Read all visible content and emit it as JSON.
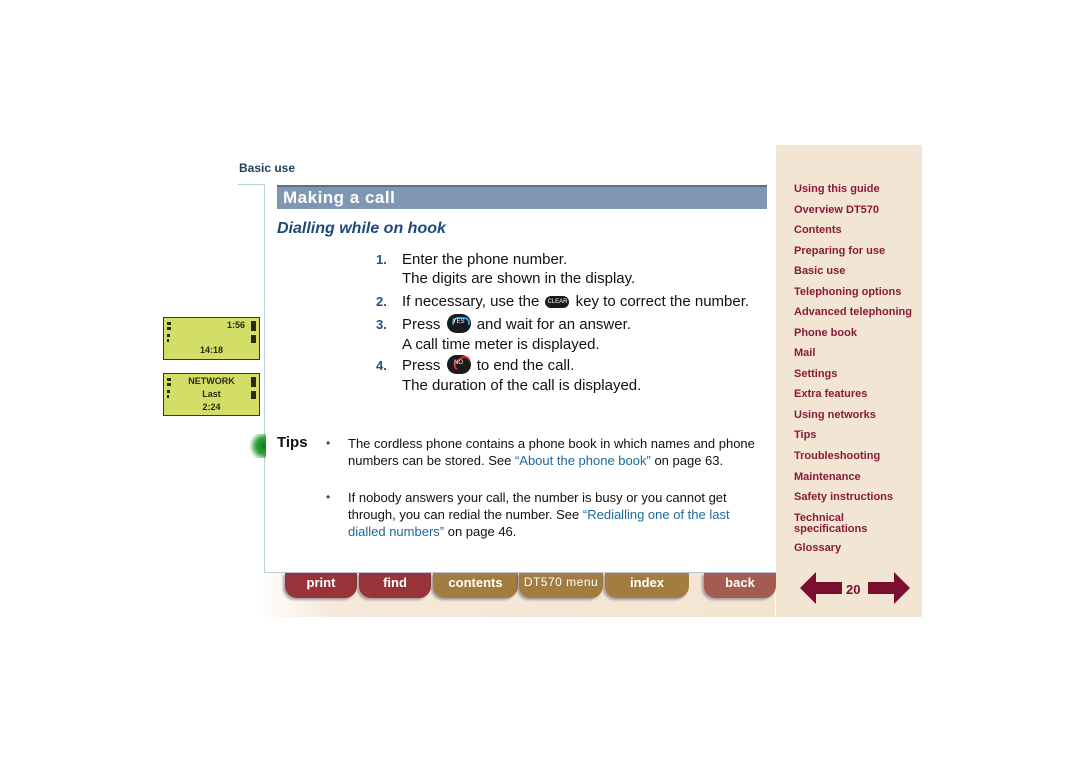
{
  "header": {
    "section": "Basic use"
  },
  "page": {
    "title": "Making a call",
    "subtitle": "Dialling while on hook",
    "steps": [
      {
        "num": "1.",
        "line1": "Enter the phone number.",
        "line2": "The digits are shown in the display."
      },
      {
        "num": "2.",
        "pre": "If necessary, use the",
        "key": "CLEAR",
        "post": "key to correct the number."
      },
      {
        "num": "3.",
        "pre": "Press",
        "key": "YES",
        "post": "and wait for an answer.",
        "line2": "A call time meter is displayed."
      },
      {
        "num": "4.",
        "pre": "Press",
        "key": "NO",
        "post": "to end the call.",
        "line2": "The duration of the call is displayed."
      }
    ],
    "tips_label": "Tips",
    "tips": [
      {
        "bullet": "•",
        "text1": "The cordless phone contains a phone book in which names and phone numbers can be stored. See ",
        "link": "“About the phone book”",
        "text2": " on page 63."
      },
      {
        "bullet": "•",
        "text1": "If nobody answers your call, the number is busy or you cannot get through, you can redial the number. See ",
        "link": "“Redialling one of the last dialled numbers”",
        "text2": " on page 46."
      }
    ]
  },
  "displays": [
    {
      "top_right": "1:56",
      "center": "14:18"
    },
    {
      "line1": "NETWORK",
      "line2": "Last",
      "line3": "2:24"
    }
  ],
  "nav_buttons": [
    {
      "label": "print",
      "color": "#983339"
    },
    {
      "label": "find",
      "color": "#983339"
    },
    {
      "label": "contents",
      "color": "#a27d3f"
    },
    {
      "label": "DT570 menu",
      "color": "#a27d3f"
    },
    {
      "label": "index",
      "color": "#a27d3f"
    },
    {
      "label": "back",
      "color": "#a35c4f"
    }
  ],
  "sidebar": {
    "items": [
      "Using this guide",
      "Overview DT570",
      "Contents",
      "Preparing for use",
      "Basic use",
      "Telephoning options",
      "Advanced telephoning",
      "Phone book",
      "Mail",
      "Settings",
      "Extra features",
      "Using networks",
      "Tips",
      "Troubleshooting",
      "Maintenance",
      "Safety instructions",
      "Technical specifications",
      "Glossary"
    ],
    "page_number": "20",
    "prev_icon": "arrow-left-icon",
    "next_icon": "arrow-right-icon"
  },
  "colors": {
    "title_bar": "#7f97b3",
    "sidebar_bg": "#f3e5d3",
    "sidebar_text": "#8a1a3a",
    "link": "#1d6a9a",
    "step_number": "#2a4f85",
    "lcd": "#d2de67"
  }
}
